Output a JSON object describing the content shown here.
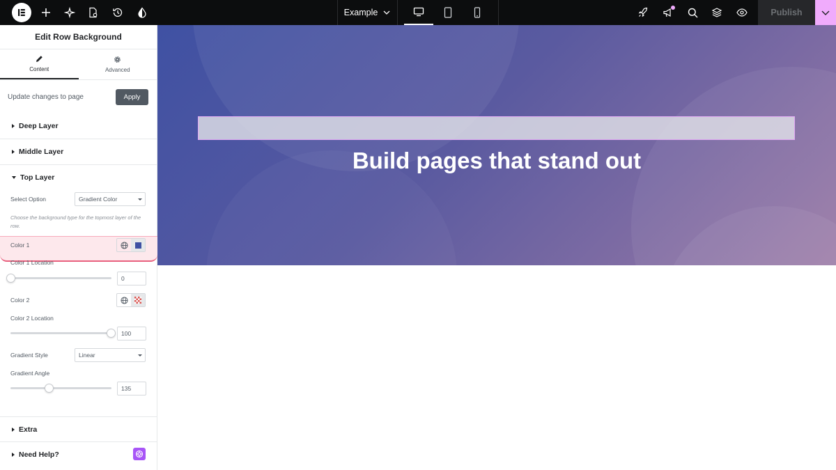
{
  "topbar": {
    "page_name": "Example",
    "publish_label": "Publish",
    "icons": [
      "elementor-logo-icon",
      "plus-icon",
      "sparkle-icon",
      "page-settings-icon",
      "history-icon",
      "theme-drop-icon",
      "chevron-down-icon",
      "desktop-icon",
      "tablet-icon",
      "mobile-icon",
      "rocket-icon",
      "announcement-icon",
      "search-icon",
      "layers-icon",
      "eye-icon"
    ]
  },
  "panel": {
    "title": "Edit Row Background",
    "tabs": [
      {
        "label": "Content"
      },
      {
        "label": "Advanced"
      }
    ],
    "apply": {
      "text": "Update changes to page",
      "button": "Apply"
    },
    "sections": {
      "deep": "Deep Layer",
      "middle": "Middle Layer",
      "top": "Top Layer",
      "extra": "Extra",
      "help": "Need Help?"
    },
    "top_layer": {
      "select_label": "Select Option",
      "select_value": "Gradient Color",
      "description": "Choose the background type for the topmost layer of the row.",
      "color1_label": "Color 1",
      "color1_value": "#3f51a3",
      "color1_location_label": "Color 1 Location",
      "color1_location": "0",
      "color2_label": "Color 2",
      "color2_location_label": "Color 2 Location",
      "color2_location": "100",
      "gradient_style_label": "Gradient Style",
      "gradient_style_value": "Linear",
      "gradient_angle_label": "Gradient Angle",
      "gradient_angle": "135"
    }
  },
  "canvas": {
    "heading": "Build pages that stand out"
  },
  "colors": {
    "accent": "#f0abfc",
    "highlight": "#e8607e",
    "help_icon": "#a855f7"
  }
}
